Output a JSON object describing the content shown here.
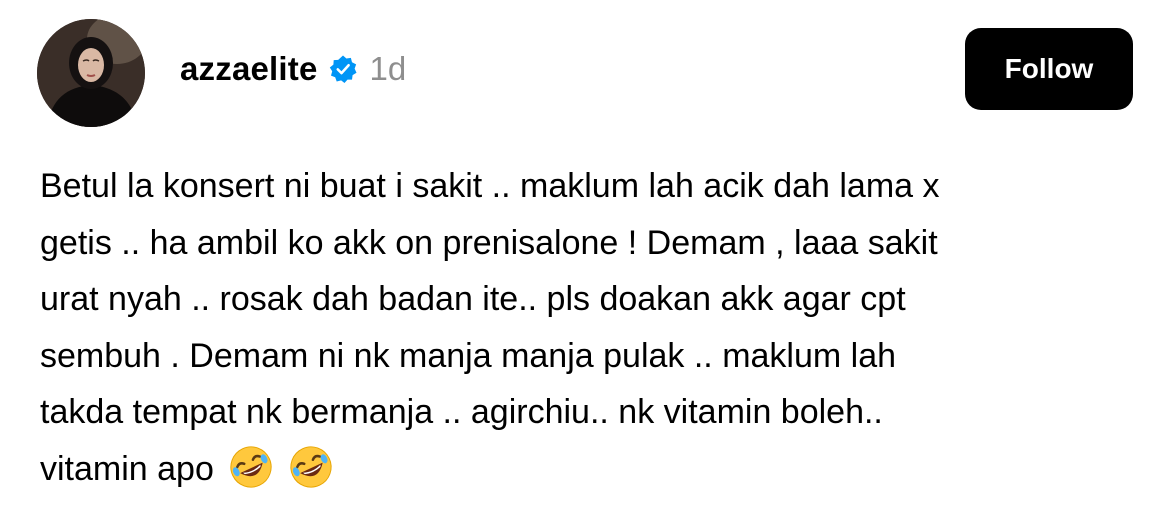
{
  "post": {
    "username": "azzaelite",
    "timestamp": "1d",
    "follow_label": "Follow",
    "verified": true,
    "lines": [
      "Betul la konsert ni buat i sakit .. maklum lah acik dah lama x",
      "getis .. ha ambil ko akk on prenisalone ! Demam , laaa sakit",
      "urat nyah .. rosak dah badan ite.. pls doakan akk agar cpt",
      "sembuh . Demam ni nk manja manja pulak .. maklum lah",
      "takda tempat nk bermanja .. agirchiu.. nk vitamin boleh..",
      "vitamin apo"
    ],
    "trailing_emojis": [
      "rolling-on-floor-laughing-emoji",
      "rolling-on-floor-laughing-emoji"
    ]
  },
  "colors": {
    "verified_blue": "#0095f6",
    "timestamp_gray": "#8e8e8e",
    "button_bg": "#000000",
    "button_text": "#ffffff"
  }
}
